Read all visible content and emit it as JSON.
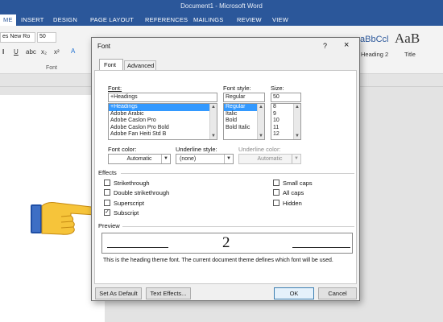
{
  "window": {
    "title": "Document1 - Microsoft Word"
  },
  "ribbon_tabs": [
    "ME",
    "INSERT",
    "DESIGN",
    "PAGE LAYOUT",
    "REFERENCES",
    "MAILINGS",
    "REVIEW",
    "VIEW"
  ],
  "ribbon": {
    "font_name": "es New Ro",
    "font_size": "50",
    "group_label": "Font",
    "style_sample": "aBbCcl",
    "style_name": "Heading 2",
    "title_sample": "AaB",
    "title_name": "Title"
  },
  "dialog": {
    "title": "Font",
    "close": "×",
    "help": "?",
    "tabs": [
      "Font",
      "Advanced"
    ],
    "font_label": "Font:",
    "font_value": "+Headings",
    "font_list": [
      "+Headings",
      "Adobe Arabic",
      "Adobe Caslon Pro",
      "Adobe Caslon Pro Bold",
      "Adobe Fan Heiti Std B"
    ],
    "style_label": "Font style:",
    "style_value": "Regular",
    "style_list": [
      "Regular",
      "Italic",
      "Bold",
      "Bold Italic"
    ],
    "size_label": "Size:",
    "size_value": "50",
    "size_list": [
      "8",
      "9",
      "10",
      "11",
      "12"
    ],
    "font_color_label": "Font color:",
    "font_color_value": "Automatic",
    "underline_style_label": "Underline style:",
    "underline_style_value": "(none)",
    "underline_color_label": "Underline color:",
    "underline_color_value": "Automatic",
    "effects_label": "Effects",
    "effects_left": [
      {
        "label": "Strikethrough",
        "checked": false
      },
      {
        "label": "Double strikethrough",
        "checked": false
      },
      {
        "label": "Superscript",
        "checked": false
      },
      {
        "label": "Subscript",
        "checked": true
      }
    ],
    "effects_right": [
      {
        "label": "Small caps",
        "checked": false
      },
      {
        "label": "All caps",
        "checked": false
      },
      {
        "label": "Hidden",
        "checked": false
      }
    ],
    "preview_label": "Preview",
    "preview_text": "2",
    "preview_note": "This is the heading theme font. The current document theme defines which font will be used.",
    "btn_default": "Set As Default",
    "btn_effects": "Text Effects...",
    "btn_ok": "OK",
    "btn_cancel": "Cancel"
  }
}
